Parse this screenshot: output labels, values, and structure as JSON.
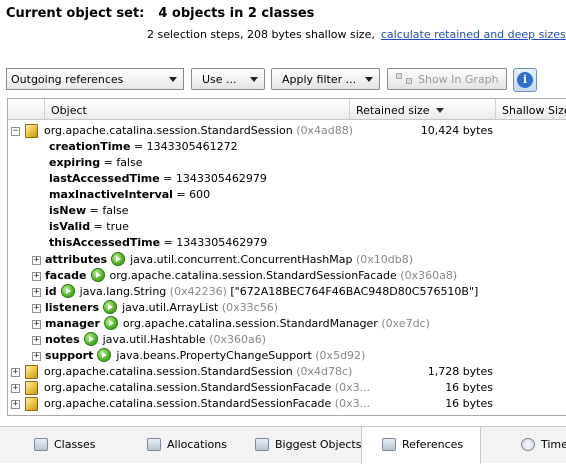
{
  "header": {
    "title_label": "Current object set:",
    "title_value": "4 objects in 2 classes",
    "summary": "2 selection steps, 208 bytes shallow size,",
    "link": "calculate retained and deep sizes"
  },
  "toolbar": {
    "view_select": "Outgoing references",
    "use_button": "Use ...",
    "filter_button": "Apply filter ...",
    "graph_button": "Show In Graph",
    "info_button": "i"
  },
  "columns": {
    "object": "Object",
    "retained": "Retained size",
    "shallow": "Shallow Size"
  },
  "tree": {
    "root": {
      "class": "org.apache.catalina.session.StandardSession",
      "id": "(0x4ad88)",
      "retained": "10,424 bytes"
    },
    "fields": [
      {
        "name": "creationTime",
        "value": " = 1343305461272"
      },
      {
        "name": "expiring",
        "value": " = false"
      },
      {
        "name": "lastAccessedTime",
        "value": " = 1343305462979"
      },
      {
        "name": "maxInactiveInterval",
        "value": " = 600"
      },
      {
        "name": "isNew",
        "value": " = false"
      },
      {
        "name": "isValid",
        "value": " = true"
      },
      {
        "name": "thisAccessedTime",
        "value": " = 1343305462979"
      }
    ],
    "refs": [
      {
        "name": "attributes",
        "type": "java.util.concurrent.ConcurrentHashMap",
        "id": "(0x10db8)",
        "extra": ""
      },
      {
        "name": "facade",
        "type": "org.apache.catalina.session.StandardSessionFacade",
        "id": "(0x360a8)",
        "extra": ""
      },
      {
        "name": "id",
        "type": "java.lang.String",
        "id": "(0x42236)",
        "extra": "[\"672A18BEC764F46BAC948D80C576510B\"]"
      },
      {
        "name": "listeners",
        "type": "java.util.ArrayList",
        "id": "(0x33c56)",
        "extra": ""
      },
      {
        "name": "manager",
        "type": "org.apache.catalina.session.StandardManager",
        "id": "(0xe7dc)",
        "extra": ""
      },
      {
        "name": "notes",
        "type": "java.util.Hashtable",
        "id": "(0x360a6)",
        "extra": ""
      },
      {
        "name": "support",
        "type": "java.beans.PropertyChangeSupport",
        "id": "(0x5d92)",
        "extra": ""
      }
    ],
    "others": [
      {
        "class": "org.apache.catalina.session.StandardSession",
        "id": "(0x4d78c)",
        "retained": "1,728 bytes"
      },
      {
        "class": "org.apache.catalina.session.StandardSessionFacade",
        "id": "(0x3...",
        "retained": "16 bytes"
      },
      {
        "class": "org.apache.catalina.session.StandardSessionFacade",
        "id": "(0x3...",
        "retained": "16 bytes"
      }
    ]
  },
  "tabs": [
    {
      "label": "Classes",
      "icon": "classes-icon"
    },
    {
      "label": "Allocations",
      "icon": "allocations-icon"
    },
    {
      "label": "Biggest Objects",
      "icon": "biggest-objects-icon"
    },
    {
      "label": "References",
      "icon": "references-icon"
    },
    {
      "label": "Time",
      "icon": "time-icon"
    }
  ]
}
